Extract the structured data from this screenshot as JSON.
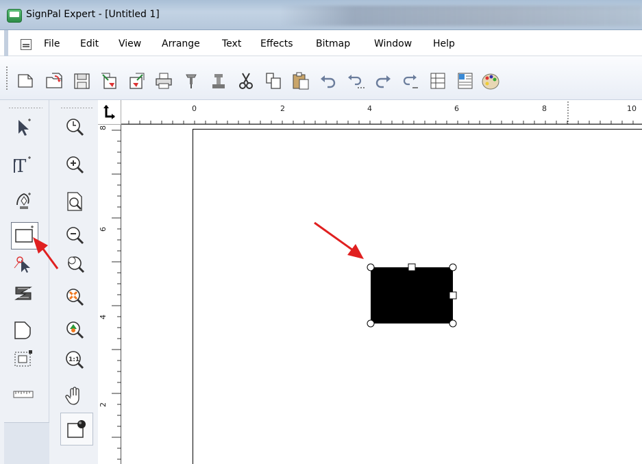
{
  "window": {
    "title": "SignPal Expert - [Untitled 1]"
  },
  "menu": {
    "items": [
      "File",
      "Edit",
      "View",
      "Arrange",
      "Text",
      "Effects",
      "Bitmap",
      "Window",
      "Help"
    ]
  },
  "toolbar": {
    "buttons": [
      "new-file-icon",
      "open-file-icon",
      "save-icon",
      "import-icon",
      "export-icon",
      "print-icon",
      "cut-path-icon",
      "plotter-icon",
      "cut-icon",
      "copy-icon",
      "paste-icon",
      "undo-icon",
      "undo-list-icon",
      "redo-icon",
      "redo-list-icon",
      "table-icon",
      "spreadsheet-icon",
      "color-palette-icon"
    ]
  },
  "toolbox": {
    "left_tools": [
      "pointer-tool-icon",
      "text-tool-icon",
      "pen-tool-icon",
      "rectangle-tool-icon",
      "node-edit-tool-icon",
      "distort-tool-icon",
      "shape-tool-icon",
      "bounding-box-tool-icon",
      "ruler-tool-icon"
    ],
    "zoom_tools": [
      "zoom-previous-icon",
      "zoom-in-icon",
      "zoom-page-icon",
      "zoom-out-icon",
      "zoom-selection-icon",
      "zoom-all-icon",
      "zoom-fit-icon",
      "zoom-1-1-icon",
      "pan-hand-icon",
      "fill-color-icon"
    ],
    "active_tool": "rectangle-tool-icon"
  },
  "ruler": {
    "horizontal_labels": [
      "0",
      "2",
      "4",
      "6",
      "8",
      "10"
    ],
    "vertical_labels": [
      "8",
      "6",
      "4",
      "2"
    ]
  },
  "colors": {
    "annotation_arrow": "#e02020",
    "selected_shape_fill": "#000000"
  }
}
